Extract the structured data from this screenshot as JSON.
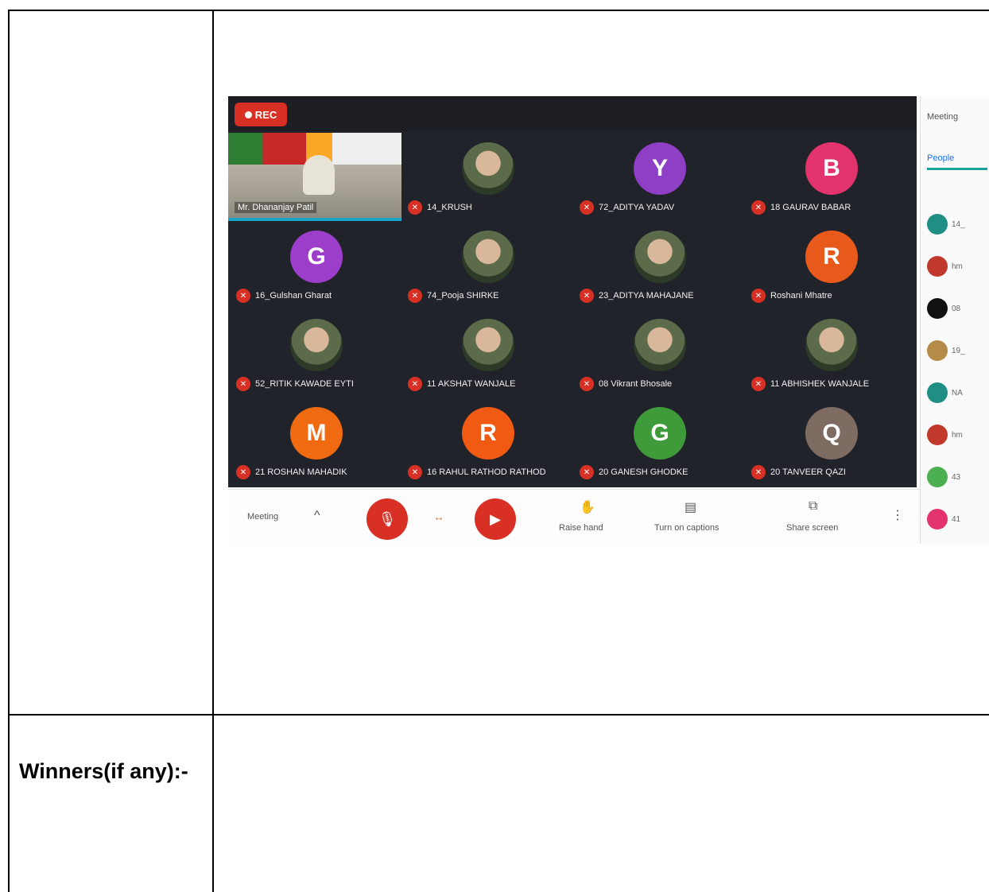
{
  "document": {
    "winners_label": "Winners(if any):-"
  },
  "screenshot": {
    "rec_label": "REC",
    "presenter_name": "Mr. Dhananjay Patil",
    "sidebar_header": "Meeting",
    "sidebar_tab": "People",
    "participants": [
      {
        "initial": "",
        "name": "14_KRUSH",
        "color": "#6d7b5a",
        "photo": true
      },
      {
        "initial": "Y",
        "name": "72_ADITYA YADAV",
        "color": "#8e3fc6",
        "photo": false
      },
      {
        "initial": "B",
        "name": "18 GAURAV BABAR",
        "color": "#e3336e",
        "photo": false
      },
      {
        "initial": "G",
        "name": "16_Gulshan Gharat",
        "color": "#9c3ec9",
        "photo": false
      },
      {
        "initial": "",
        "name": "74_Pooja SHIRKE",
        "color": "#1f8f84",
        "photo": true
      },
      {
        "initial": "",
        "name": "23_ADITYA MAHAJANE",
        "color": "#111111",
        "photo": true
      },
      {
        "initial": "R",
        "name": "Roshani Mhatre",
        "color": "#e85a1b",
        "photo": false
      },
      {
        "initial": "",
        "name": "52_RITIK KAWADE EYTI",
        "color": "#7a9b5a",
        "photo": true
      },
      {
        "initial": "",
        "name": "11 AKSHAT WANJALE",
        "color": "#6b4e8a",
        "photo": true
      },
      {
        "initial": "",
        "name": "08 Vikrant Bhosale",
        "color": "#4e7a4a",
        "photo": true
      },
      {
        "initial": "",
        "name": "11 ABHISHEK WANJALE",
        "color": "#8a5a3a",
        "photo": true
      },
      {
        "initial": "M",
        "name": "21 ROSHAN MAHADIK",
        "color": "#f06a12",
        "photo": false
      },
      {
        "initial": "R",
        "name": "16 RAHUL RATHOD RATHOD",
        "color": "#f05a12",
        "photo": false
      },
      {
        "initial": "G",
        "name": "20 GANESH GHODKE",
        "color": "#3f9a3a",
        "photo": false
      },
      {
        "initial": "Q",
        "name": "20 TANVEER QAZI",
        "color": "#7e6b62",
        "photo": false
      }
    ],
    "sidebar_people": [
      {
        "name": "14_",
        "color": "#1f8f84"
      },
      {
        "name": "hm",
        "color": "#c0392b"
      },
      {
        "name": "08",
        "color": "#111111"
      },
      {
        "name": "19_",
        "color": "#b58b4a"
      },
      {
        "name": "NA",
        "color": "#1f8f84"
      },
      {
        "name": "hm",
        "color": "#c0392b"
      },
      {
        "name": "43",
        "color": "#4caf50"
      },
      {
        "name": "41",
        "color": "#e3336e"
      }
    ],
    "bottom": {
      "meeting_label": "Meeting",
      "raise_hand": "Raise hand",
      "turn_on_captions": "Turn on captions",
      "share_screen": "Share screen"
    }
  }
}
